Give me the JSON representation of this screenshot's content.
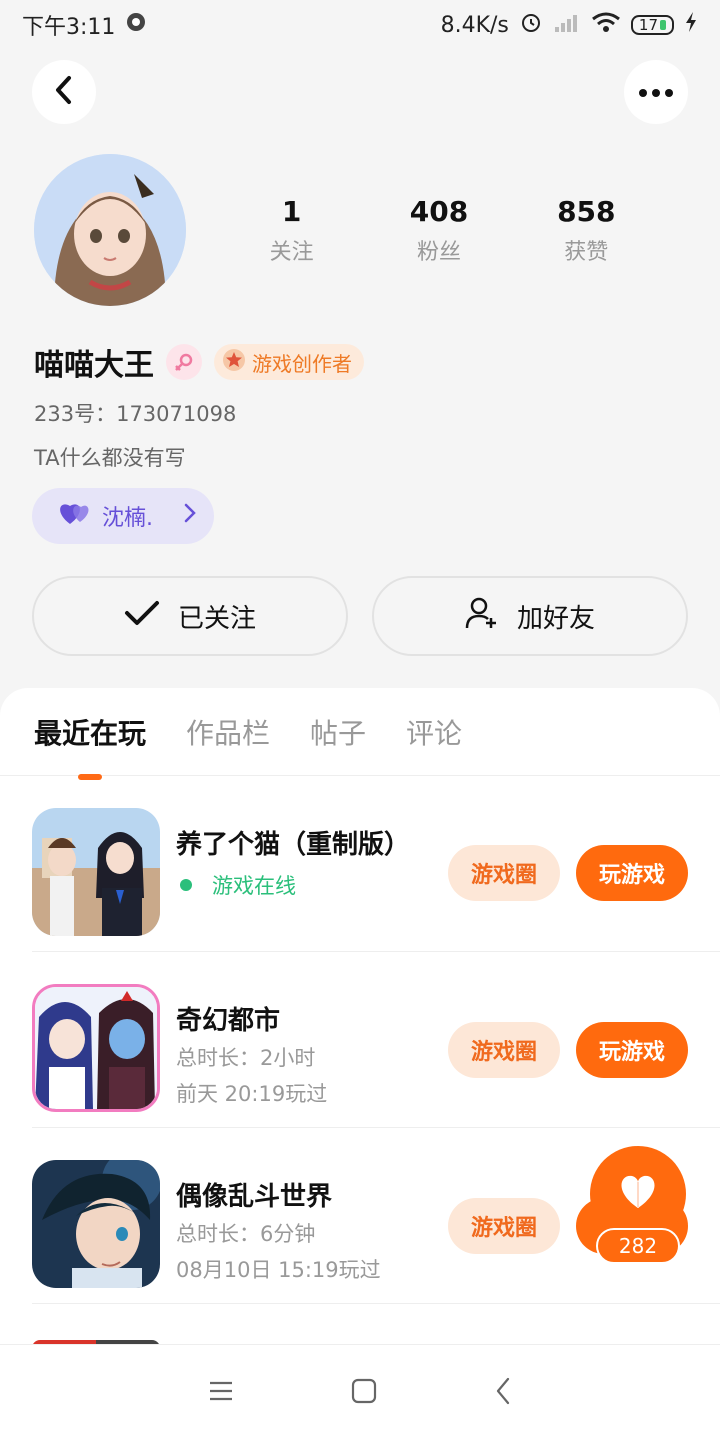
{
  "status_bar": {
    "time": "下午3:11",
    "net_speed": "8.4K/s",
    "battery": "17"
  },
  "profile": {
    "name": "喵喵大王",
    "creator_badge": "游戏创作者",
    "uid": "233号：173071098",
    "bio": "TA什么都没有写",
    "cp_name": "沈楠.",
    "stats": [
      {
        "num": "1",
        "label": "关注"
      },
      {
        "num": "408",
        "label": "粉丝"
      },
      {
        "num": "858",
        "label": "获赞"
      }
    ]
  },
  "actions": {
    "following_label": "已关注",
    "add_friend_label": "加好友"
  },
  "tabs": [
    "最近在玩",
    "作品栏",
    "帖子",
    "评论"
  ],
  "games": [
    {
      "title": "养了个猫（重制版）",
      "status": "游戏在线",
      "circle_label": "游戏圈",
      "play_label": "玩游戏"
    },
    {
      "title": "奇幻都市",
      "duration": "总时长：2小时",
      "last_played": "前天 20:19玩过",
      "circle_label": "游戏圈",
      "play_label": "玩游戏"
    },
    {
      "title": "偶像乱斗世界",
      "duration": "总时长：6分钟",
      "last_played": "08月10日 15:19玩过",
      "circle_label": "游戏圈"
    }
  ],
  "fab": {
    "count": "282"
  },
  "colors": {
    "accent": "#ff6a0e",
    "online": "#2bbf7b",
    "cp": "#6650d8"
  }
}
